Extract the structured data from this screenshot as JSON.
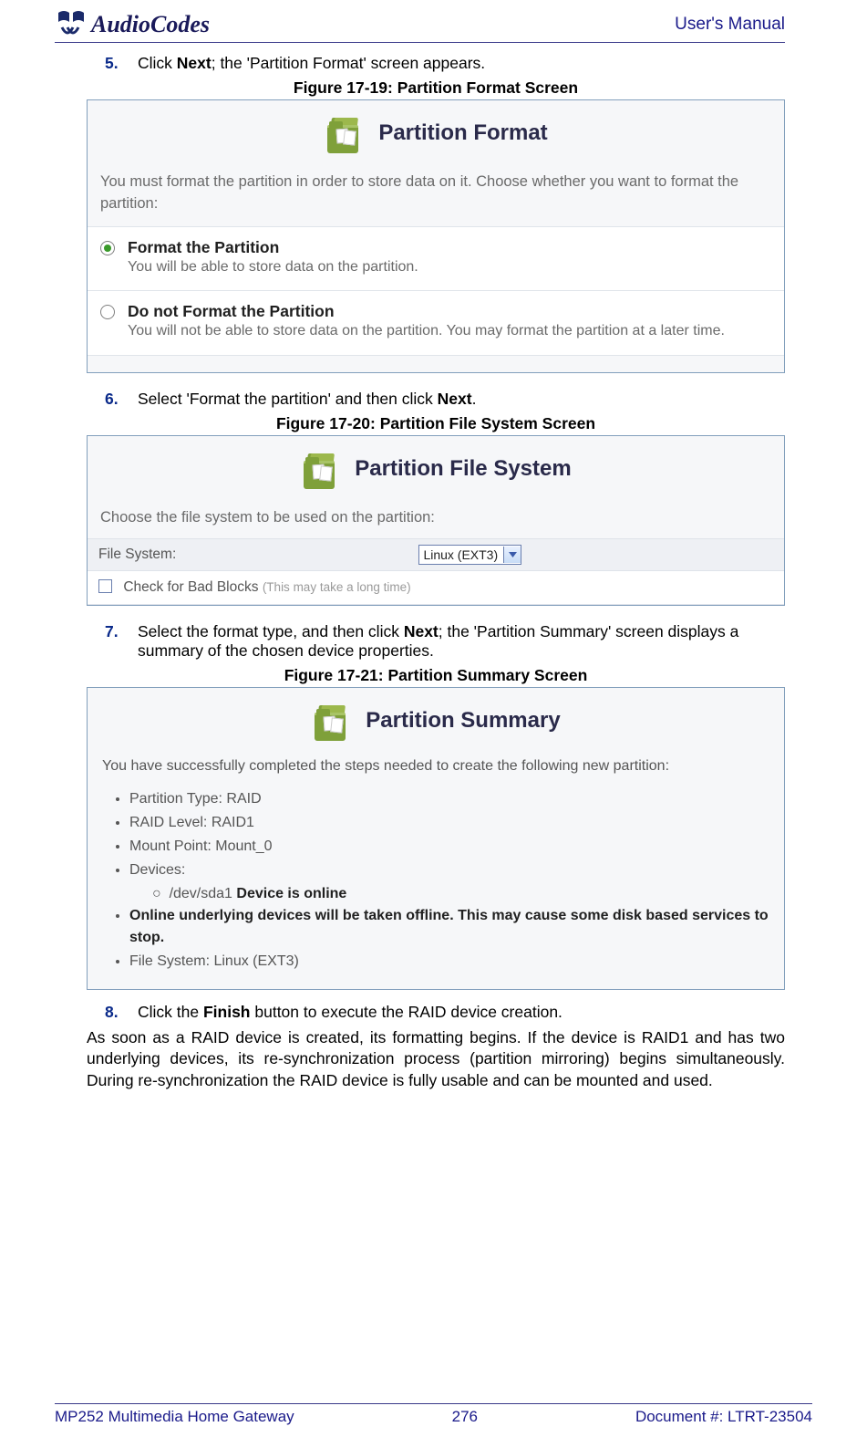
{
  "header": {
    "brand": "AudioCodes",
    "manual": "User's Manual"
  },
  "steps": {
    "s5": {
      "num": "5.",
      "pre": "Click ",
      "bold1": "Next",
      "post": "; the 'Partition Format' screen appears."
    },
    "s6": {
      "num": "6.",
      "pre": "Select 'Format the partition' and then click ",
      "bold1": "Next",
      "post": "."
    },
    "s7": {
      "num": "7.",
      "pre": "Select the format type, and then click ",
      "bold1": "Next",
      "post": "; the 'Partition Summary' screen displays a summary of the chosen device properties."
    },
    "s8": {
      "num": "8.",
      "pre": "Click the ",
      "bold1": "Finish",
      "post": " button to execute the RAID device creation."
    }
  },
  "captions": {
    "c1": "Figure 17-19: Partition Format Screen",
    "c2": "Figure 17-20: Partition File System Screen",
    "c3": "Figure 17-21: Partition Summary Screen"
  },
  "fig1": {
    "title": "Partition Format",
    "intro": "You must format the partition in order to store data on it. Choose whether you want to format the partition:",
    "opt1": {
      "title": "Format the Partition",
      "sub": "You will be able to store data on the partition."
    },
    "opt2": {
      "title": "Do not Format the Partition",
      "sub": "You will not be able to store data on the partition. You may format the partition at a later time."
    }
  },
  "fig2": {
    "title": "Partition File System",
    "intro": "Choose the file system to be used on the partition:",
    "fsLabel": "File System:",
    "fsValue": "Linux (EXT3)",
    "cbLabel": "Check for Bad Blocks",
    "cbHint": "(This may take a long time)"
  },
  "fig3": {
    "title": "Partition Summary",
    "intro": "You have successfully completed the steps needed to create the following new partition:",
    "li1": "Partition Type: RAID",
    "li2": "RAID Level: RAID1",
    "li3": "Mount Point: Mount_0",
    "li4": "Devices:",
    "sub_pre": "/dev/sda1 ",
    "sub_bold": "Device is online",
    "li5": "Online underlying devices will be taken offline. This may cause some disk based services to stop.",
    "li6": "File System: Linux (EXT3)"
  },
  "closing": "As soon as a RAID device is created, its formatting begins. If the device is RAID1 and has two underlying devices, its re-synchronization process (partition mirroring) begins simultaneously. During re-synchronization the RAID device is fully usable and can be mounted and used.",
  "footer": {
    "left": "MP252 Multimedia Home Gateway",
    "mid": "276",
    "right": "Document #: LTRT-23504"
  }
}
